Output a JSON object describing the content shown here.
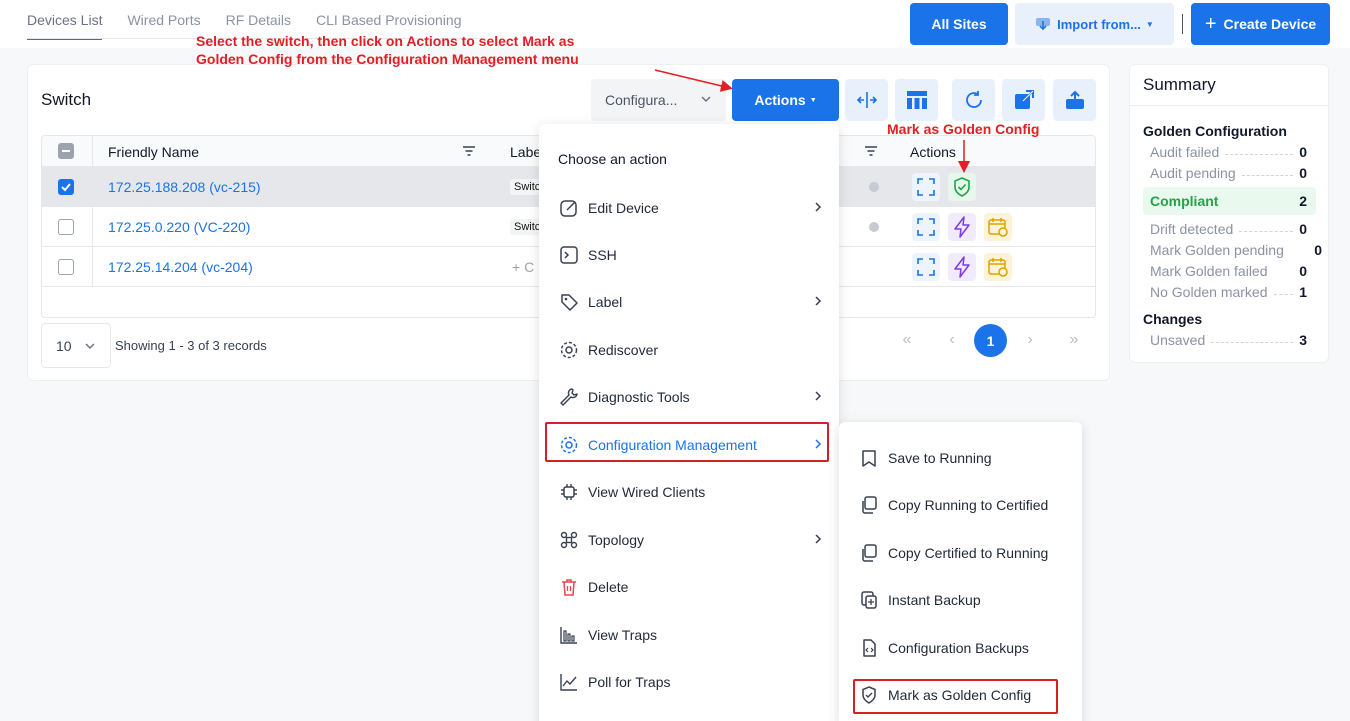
{
  "tabs": [
    "Devices List",
    "Wired Ports",
    "RF Details",
    "CLI Based Provisioning"
  ],
  "header_buttons": {
    "all_sites": "All Sites",
    "import": "Import from...",
    "create": "Create Device"
  },
  "annotations": {
    "main_line1": "Select the switch, then click on Actions to select Mark as",
    "main_line2": "Golden Config from the Configuration Management menu",
    "golden": "Mark as Golden Config"
  },
  "panel": {
    "title": "Switch",
    "config_dropdown": "Configura...",
    "actions_button": "Actions"
  },
  "table": {
    "columns": {
      "friendly_name": "Friendly Name",
      "labels": "Labe",
      "actions": "Actions"
    },
    "rows": [
      {
        "name": "172.25.188.208 (vc-215)",
        "label": "Switc",
        "selected": true
      },
      {
        "name": "172.25.0.220 (VC-220)",
        "label": "Switc",
        "selected": false
      },
      {
        "name": "172.25.14.204 (vc-204)",
        "label": "+ C",
        "selected": false
      }
    ]
  },
  "pagination": {
    "page_size": "10",
    "records": "Showing 1 - 3 of 3 records",
    "current_page": "1"
  },
  "summary": {
    "title": "Summary",
    "golden_heading": "Golden Configuration",
    "items": [
      {
        "label": "Audit failed",
        "value": "0"
      },
      {
        "label": "Audit pending",
        "value": "0"
      },
      {
        "label": "Compliant",
        "value": "2"
      },
      {
        "label": "Drift detected",
        "value": "0"
      },
      {
        "label": "Mark Golden pending",
        "value": "0"
      },
      {
        "label": "Mark Golden failed",
        "value": "0"
      },
      {
        "label": "No Golden marked",
        "value": "1"
      }
    ],
    "changes_heading": "Changes",
    "changes": [
      {
        "label": "Unsaved",
        "value": "3"
      }
    ]
  },
  "action_menu": {
    "heading": "Choose an action",
    "items": [
      {
        "label": "Edit Device",
        "icon": "edit-icon",
        "submenu": true
      },
      {
        "label": "SSH",
        "icon": "terminal-icon",
        "submenu": false
      },
      {
        "label": "Label",
        "icon": "tag-icon",
        "submenu": true
      },
      {
        "label": "Rediscover",
        "icon": "gear-icon",
        "submenu": false
      },
      {
        "label": "Diagnostic Tools",
        "icon": "wrench-icon",
        "submenu": true
      },
      {
        "label": "Configuration Management",
        "icon": "gear-icon",
        "submenu": true
      },
      {
        "label": "View Wired Clients",
        "icon": "chip-icon",
        "submenu": false
      },
      {
        "label": "Topology",
        "icon": "topology-icon",
        "submenu": true
      },
      {
        "label": "Delete",
        "icon": "trash-icon",
        "submenu": false
      },
      {
        "label": "View Traps",
        "icon": "bar-chart-icon",
        "submenu": false
      },
      {
        "label": "Poll for Traps",
        "icon": "line-chart-icon",
        "submenu": false
      }
    ]
  },
  "config_submenu": {
    "items": [
      {
        "label": "Save to Running",
        "icon": "save-icon"
      },
      {
        "label": "Copy Running to Certified",
        "icon": "copy-icon"
      },
      {
        "label": "Copy Certified to Running",
        "icon": "copy-icon"
      },
      {
        "label": "Instant Backup",
        "icon": "backup-icon"
      },
      {
        "label": "Configuration Backups",
        "icon": "code-file-icon"
      },
      {
        "label": "Mark as Golden Config",
        "icon": "shield-check-icon"
      }
    ]
  },
  "colors": {
    "primary": "#1a73e8",
    "annotation": "#e31e24",
    "compliant": "#22a447"
  }
}
